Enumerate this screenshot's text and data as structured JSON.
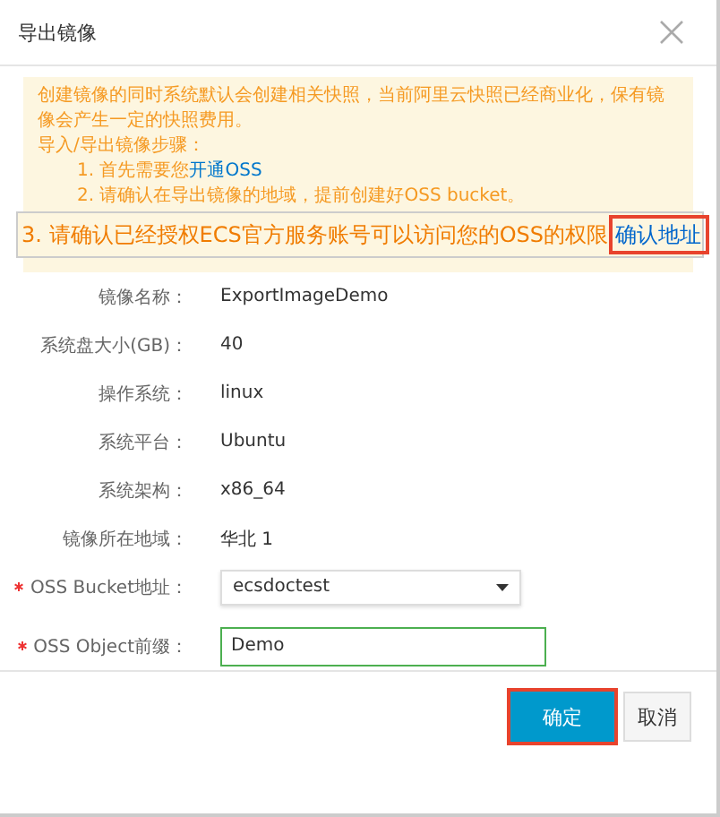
{
  "dialog": {
    "title": "导出镜像"
  },
  "notice": {
    "intro": "创建镜像的同时系统默认会创建相关快照，当前阿里云快照已经商业化，保有镜像会产生一定的快照费用。",
    "steps_title": "导入/导出镜像步骤：",
    "steps": [
      {
        "text": "1. 首先需要您",
        "link": "开通OSS"
      },
      {
        "text": "2. 请确认在导出镜像的地域，提前创建好OSS bucket。"
      }
    ]
  },
  "callout": {
    "text": "3. 请确认已经授权ECS官方服务账号可以访问您的OSS的权限",
    "link": "确认地址",
    "highlighted": true
  },
  "fields": [
    {
      "kind": "text",
      "label": "镜像名称：",
      "value": "ExportImageDemo"
    },
    {
      "kind": "text",
      "label": "系统盘大小(GB)：",
      "value": "40"
    },
    {
      "kind": "text",
      "label": "操作系统：",
      "value": "linux"
    },
    {
      "kind": "text",
      "label": "系统平台：",
      "value": "Ubuntu"
    },
    {
      "kind": "text",
      "label": "系统架构：",
      "value": "x86_64"
    },
    {
      "kind": "text",
      "label": "镜像所在地域：",
      "value": "华北 1"
    },
    {
      "kind": "select",
      "label": "OSS Bucket地址：",
      "value": "ecsdoctest",
      "required": true
    },
    {
      "kind": "input",
      "label": "OSS Object前缀：",
      "value": "Demo",
      "required": true
    }
  ],
  "buttons": [
    {
      "label": "确定",
      "primary": true,
      "highlighted": true
    },
    {
      "label": "取消",
      "primary": false,
      "highlighted": false
    }
  ]
}
